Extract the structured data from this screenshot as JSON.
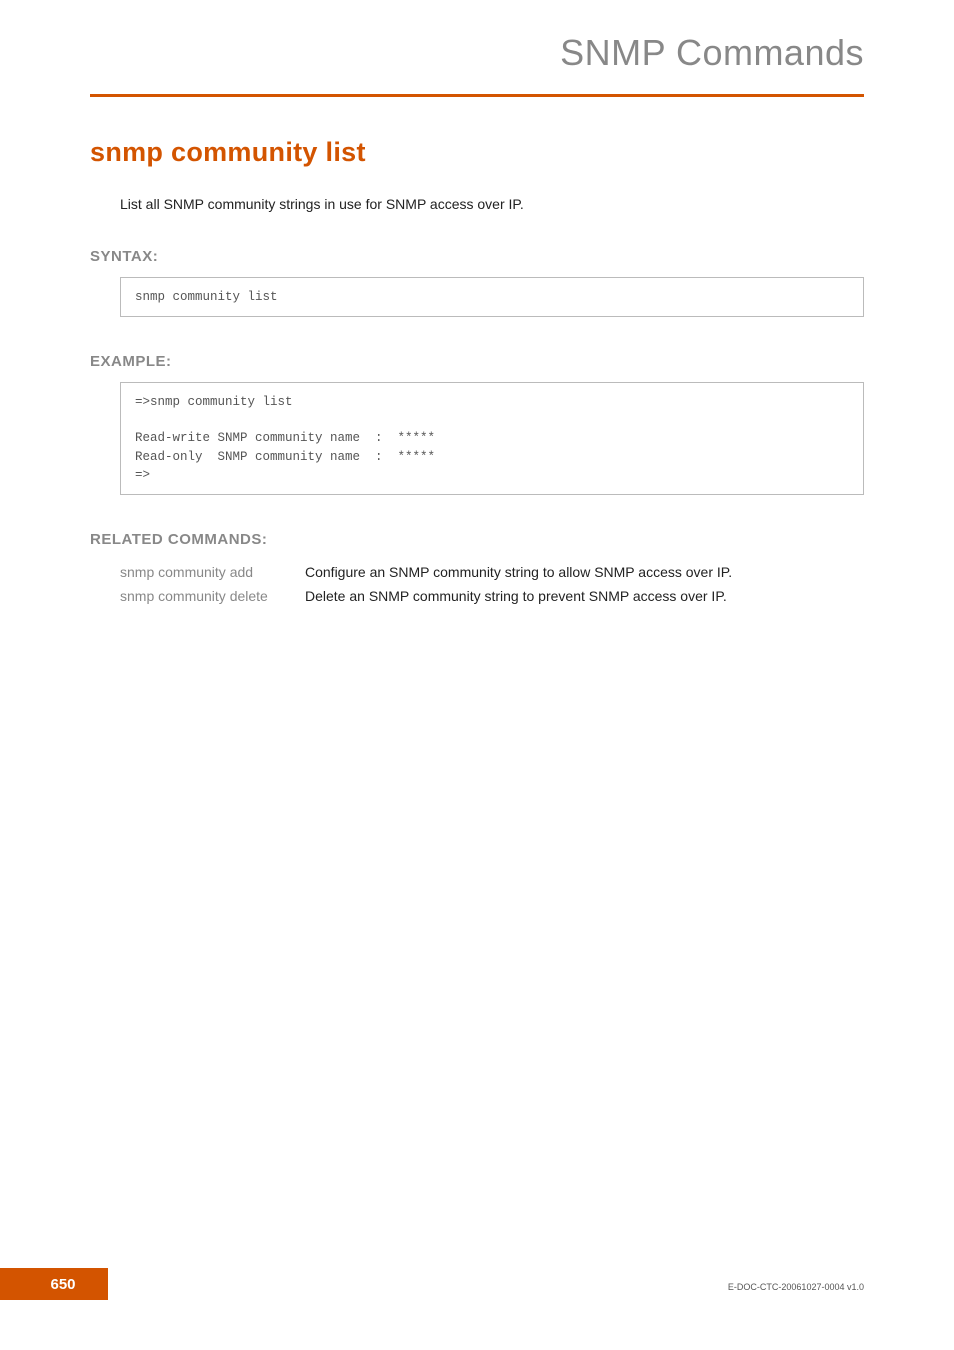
{
  "header": {
    "title": "SNMP Commands"
  },
  "command": {
    "title": "snmp community list",
    "intro": "List all SNMP community strings in use for SNMP access over IP."
  },
  "syntax": {
    "heading": "SYNTAX:",
    "code": "snmp community list"
  },
  "example": {
    "heading": "EXAMPLE:",
    "code": "=>snmp community list\n\nRead-write SNMP community name  :  *****\nRead-only  SNMP community name  :  *****\n=>"
  },
  "related": {
    "heading": "RELATED COMMANDS:",
    "rows": [
      {
        "cmd": "snmp community add",
        "desc": "Configure an SNMP community string to allow SNMP access over IP."
      },
      {
        "cmd": "snmp community delete",
        "desc": "Delete an SNMP community string to prevent SNMP access over IP."
      }
    ]
  },
  "footer": {
    "page": "650",
    "docid": "E-DOC-CTC-20061027-0004 v1.0"
  }
}
